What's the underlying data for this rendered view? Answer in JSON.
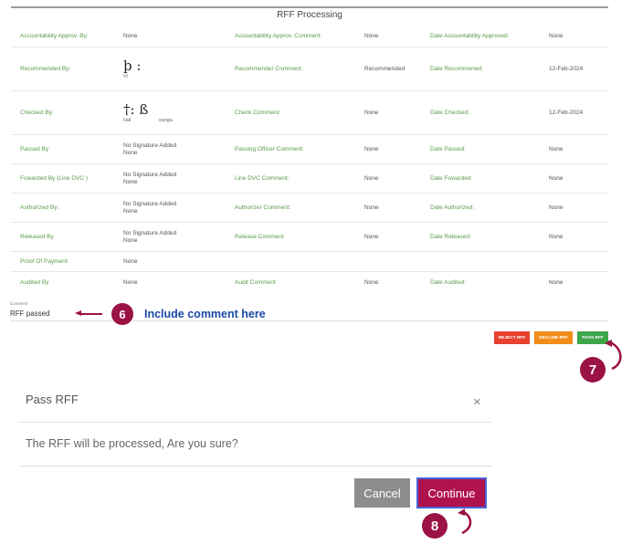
{
  "card": {
    "title": "RFF Processing",
    "rows": [
      {
        "label_a": "Accountability Approv. By:",
        "value_a": "None",
        "label_b": "Accountability Approv. Comment:",
        "value_b": "None",
        "label_c": "Date Accountability Approved:",
        "value_c": "None"
      },
      {
        "label_a": "Recommended By:",
        "value_a": "Vi",
        "sig": "þ :",
        "label_b": "Recommender Comment:",
        "value_b": "Recommended",
        "label_c": "Date Recommened:",
        "value_c": "12-Feb-2024"
      },
      {
        "label_a": "Checked By:",
        "value_a": "Hal                    sanga",
        "sig": "†: ß",
        "label_b": "Check Comment:",
        "value_b": "None",
        "label_c": "Date Checked:",
        "value_c": "12-Feb-2024"
      },
      {
        "label_a": "Passed By",
        "value_a": "No Signature Added",
        "value_a2": "None",
        "label_b": "Passing Officer Comment:",
        "value_b": "None",
        "label_c": "Date Passed:",
        "value_c": "None"
      },
      {
        "label_a": "Fowarded By (Line DVC )",
        "value_a": "No Signature Added",
        "value_a2": "None",
        "label_b": "Line DVC Comment:",
        "value_b": "None",
        "label_c": "Date Fowarded:",
        "value_c": "None"
      },
      {
        "label_a": "Authorized By:",
        "value_a": "No Signature Added",
        "value_a2": "None",
        "label_b": "Authorizer Comment:",
        "value_b": "None",
        "label_c": "Date Authorized:",
        "value_c": "None"
      },
      {
        "label_a": "Released By",
        "value_a": "No Signature Added",
        "value_a2": "None",
        "label_b": "Release Comment",
        "value_b": "None",
        "label_c": "Date Released:",
        "value_c": "None"
      },
      {
        "label_a": "Proof Of Payment:",
        "value_a": "None",
        "label_b": "",
        "value_b": "",
        "label_c": "",
        "value_c": ""
      },
      {
        "label_a": "Audited By",
        "value_a": "None",
        "label_b": "Audit Comment",
        "value_b": "None",
        "label_c": "Date Audited:",
        "value_c": "None"
      }
    ]
  },
  "comment": {
    "label": "Comment",
    "value": "RFF passed"
  },
  "annotations": {
    "step6": "6",
    "step6_text": "Include comment here",
    "step7": "7",
    "step8": "8"
  },
  "actions": {
    "reject": "REJECT RFF",
    "decline": "DECLINE RFF",
    "pass": "PASS RFF"
  },
  "modal": {
    "title": "Pass RFF",
    "close": "×",
    "message": "The RFF will be processed, Are you sure?",
    "cancel": "Cancel",
    "continue": "Continue"
  },
  "colors": {
    "accent": "#9b1245",
    "label_green": "#5a9a4a",
    "reject": "#e8402f",
    "decline": "#f28c1a",
    "pass": "#3fa64a",
    "continue": "#b0124f",
    "cancel": "#8d8d8d"
  },
  "icons": {
    "close": "close-icon",
    "arrow": "arrow-left-icon",
    "curl": "curved-arrow-icon"
  }
}
